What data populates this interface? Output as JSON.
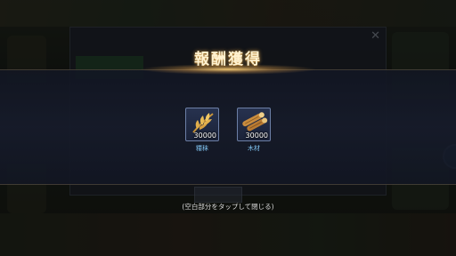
{
  "dialog": {
    "title": "報酬獲得",
    "rewards": [
      {
        "name": "糧秣",
        "count": "30000",
        "icon": "wheat-icon"
      },
      {
        "name": "木材",
        "count": "30000",
        "icon": "wood-log-icon"
      }
    ],
    "hint": "(空白部分をタップして閉じる)"
  },
  "colors": {
    "title": "#fff2d0",
    "item_label": "#7fc3f0",
    "band": "#161b2a"
  }
}
